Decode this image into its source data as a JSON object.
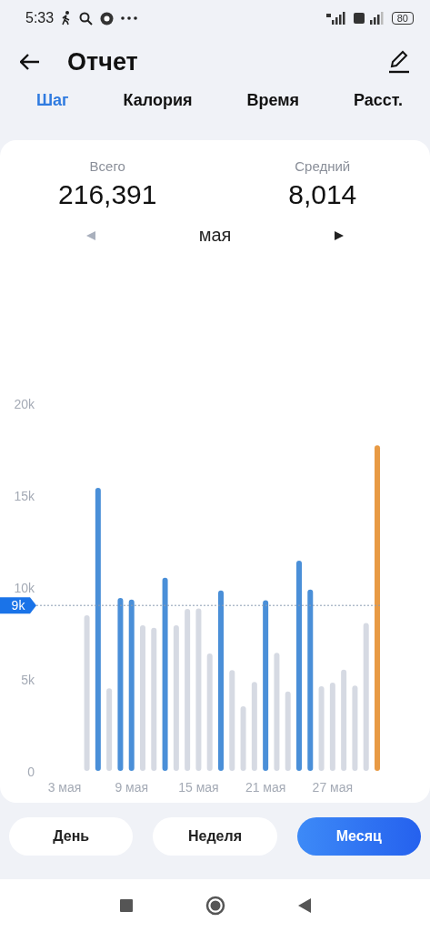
{
  "status_bar": {
    "time": "5:33",
    "battery": "80"
  },
  "header": {
    "title": "Отчет"
  },
  "tabs": [
    {
      "label": "Шаг",
      "selected": true
    },
    {
      "label": "Калория",
      "selected": false
    },
    {
      "label": "Время",
      "selected": false
    },
    {
      "label": "Расст.",
      "selected": false
    }
  ],
  "summary": [
    {
      "label": "Всего",
      "value": "216,391"
    },
    {
      "label": "Средний",
      "value": "8,014"
    }
  ],
  "period": {
    "label": "мая",
    "prev_enabled": false,
    "next_enabled": true
  },
  "chart_data": {
    "type": "bar",
    "x": [
      5,
      6,
      7,
      8,
      9,
      10,
      11,
      12,
      13,
      14,
      15,
      16,
      17,
      18,
      19,
      20,
      21,
      22,
      23,
      24,
      25,
      26,
      27,
      28,
      29,
      30,
      31
    ],
    "series": [
      {
        "color": "#4a8fd8",
        "values": [
          null,
          15400,
          null,
          9410,
          9320,
          null,
          null,
          10510,
          null,
          null,
          null,
          null,
          9820,
          null,
          null,
          null,
          9280,
          null,
          null,
          11440,
          9870,
          null,
          null,
          null,
          null,
          null,
          null
        ]
      },
      {
        "color": "#d6dae3",
        "values": [
          8470,
          null,
          4490,
          null,
          null,
          7920,
          7790,
          null,
          7920,
          8810,
          8840,
          6390,
          null,
          5480,
          3520,
          4840,
          null,
          6420,
          4320,
          null,
          null,
          4600,
          4800,
          5510,
          4640,
          8040,
          null
        ]
      },
      {
        "color": "#e89a44",
        "values": [
          null,
          null,
          null,
          null,
          null,
          null,
          null,
          null,
          null,
          null,
          null,
          null,
          null,
          null,
          null,
          null,
          null,
          null,
          null,
          null,
          null,
          null,
          null,
          null,
          null,
          null,
          17710
        ]
      }
    ],
    "xlim": [
      3,
      31
    ],
    "stacked": false,
    "ylim": [
      0,
      20000
    ],
    "yticks": [
      0,
      {
        "value": 5000,
        "label": "5k"
      },
      {
        "value": 10000,
        "label": "10k"
      },
      {
        "value": 15000,
        "label": "15k"
      },
      {
        "value": 20000,
        "label": "20k"
      }
    ],
    "xticks": [
      {
        "value": 3,
        "label": "3 мая"
      },
      {
        "value": 9,
        "label": "9 мая"
      },
      {
        "value": 15,
        "label": "15 мая"
      },
      {
        "value": 21,
        "label": "21 мая"
      },
      {
        "value": 27,
        "label": "27 мая"
      }
    ],
    "ref_lines": [
      {
        "axis": "y",
        "value": 9000,
        "label": "9k"
      }
    ]
  },
  "range_buttons": [
    {
      "label": "День",
      "selected": false
    },
    {
      "label": "Неделя",
      "selected": false
    },
    {
      "label": "Месяц",
      "selected": true
    }
  ]
}
